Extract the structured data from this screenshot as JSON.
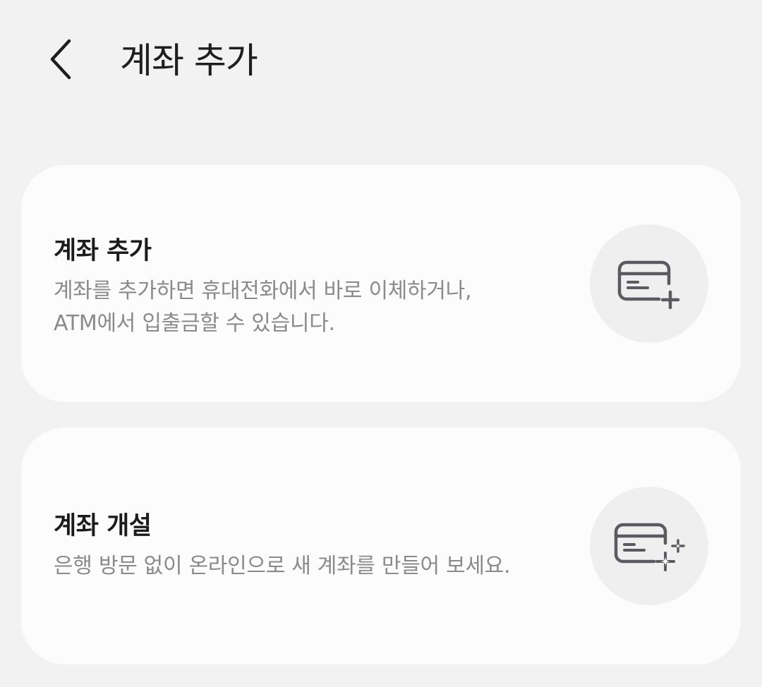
{
  "header": {
    "back_icon": "chevron-left-icon",
    "title": "계좌 추가"
  },
  "options": [
    {
      "title": "계좌 추가",
      "description": "계좌를 추가하면 휴대전화에서 바로 이체하거나,\nATM에서 입출금할 수 있습니다.",
      "icon": "card-add-icon"
    },
    {
      "title": "계좌 개설",
      "description": "은행 방문 없이 온라인으로 새 계좌를 만들어 보세요.",
      "icon": "card-sparkle-icon"
    }
  ],
  "colors": {
    "background": "#f2f2f2",
    "card": "#fcfcfc",
    "icon_circle": "#efefef",
    "icon_stroke": "#5a5a60",
    "description_text": "#8a8a8a"
  }
}
